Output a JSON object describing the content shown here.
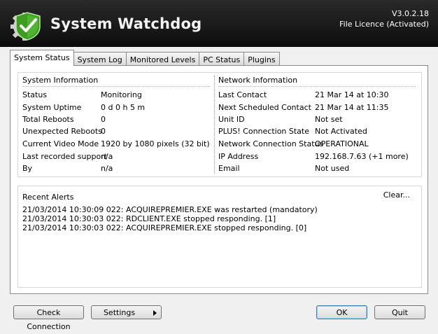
{
  "header": {
    "title": "System Watchdog",
    "version": "V3.0.2.18",
    "licence": "File Licence (Activated)"
  },
  "tabs": [
    {
      "label": "System Status",
      "active": true
    },
    {
      "label": "System Log"
    },
    {
      "label": "Monitored Levels"
    },
    {
      "label": "PC Status"
    },
    {
      "label": "Plugins"
    }
  ],
  "system_info": {
    "title": "System Information",
    "rows": [
      {
        "label": "Status",
        "value": "Monitoring"
      },
      {
        "label": "System Uptime",
        "value": "0 d 0 h 5 m"
      },
      {
        "label": "Total Reboots",
        "value": "0"
      },
      {
        "label": "Unexpected Reboots",
        "value": "0"
      },
      {
        "label": "Current Video Mode",
        "value": "1920 by 1080 pixels (32 bit)"
      },
      {
        "label": "Last recorded support",
        "value": "n/a"
      },
      {
        "label": "By",
        "value": "n/a"
      }
    ]
  },
  "network_info": {
    "title": "Network Information",
    "rows": [
      {
        "label": "Last Contact",
        "value": "21 Mar 14 at 10:30"
      },
      {
        "label": "Next Scheduled Contact",
        "value": "21 Mar 14 at 11:35"
      },
      {
        "label": "Unit ID",
        "value": "Not set"
      },
      {
        "label": "PLUS! Connection State",
        "value": "Not Activated"
      },
      {
        "label": "Network Connection Status",
        "value": "OPERATIONAL"
      },
      {
        "label": "IP Address",
        "value": "192.168.7.63 (+1 more)"
      },
      {
        "label": "Email",
        "value": "Not used"
      }
    ]
  },
  "alerts": {
    "title": "Recent Alerts",
    "clear_label": "Clear...",
    "lines": [
      "21/03/2014 10:30:09 022: ACQUIREPREMIER.EXE was restarted (mandatory)",
      "21/03/2014 10:30:03 022: RDCLIENT.EXE stopped responding. [1]",
      "21/03/2014 10:30:03 022: ACQUIREPREMIER.EXE stopped responding. [0]"
    ]
  },
  "buttons": {
    "check_connection": "Check Connection",
    "settings": "Settings",
    "ok": "OK",
    "quit": "Quit"
  },
  "icons": {
    "logo": "gear-shield-check-icon",
    "settings_arrow": "triangle-right-icon"
  },
  "colors": {
    "header_bg": "#141414",
    "logo_green": "#4caf2a"
  }
}
